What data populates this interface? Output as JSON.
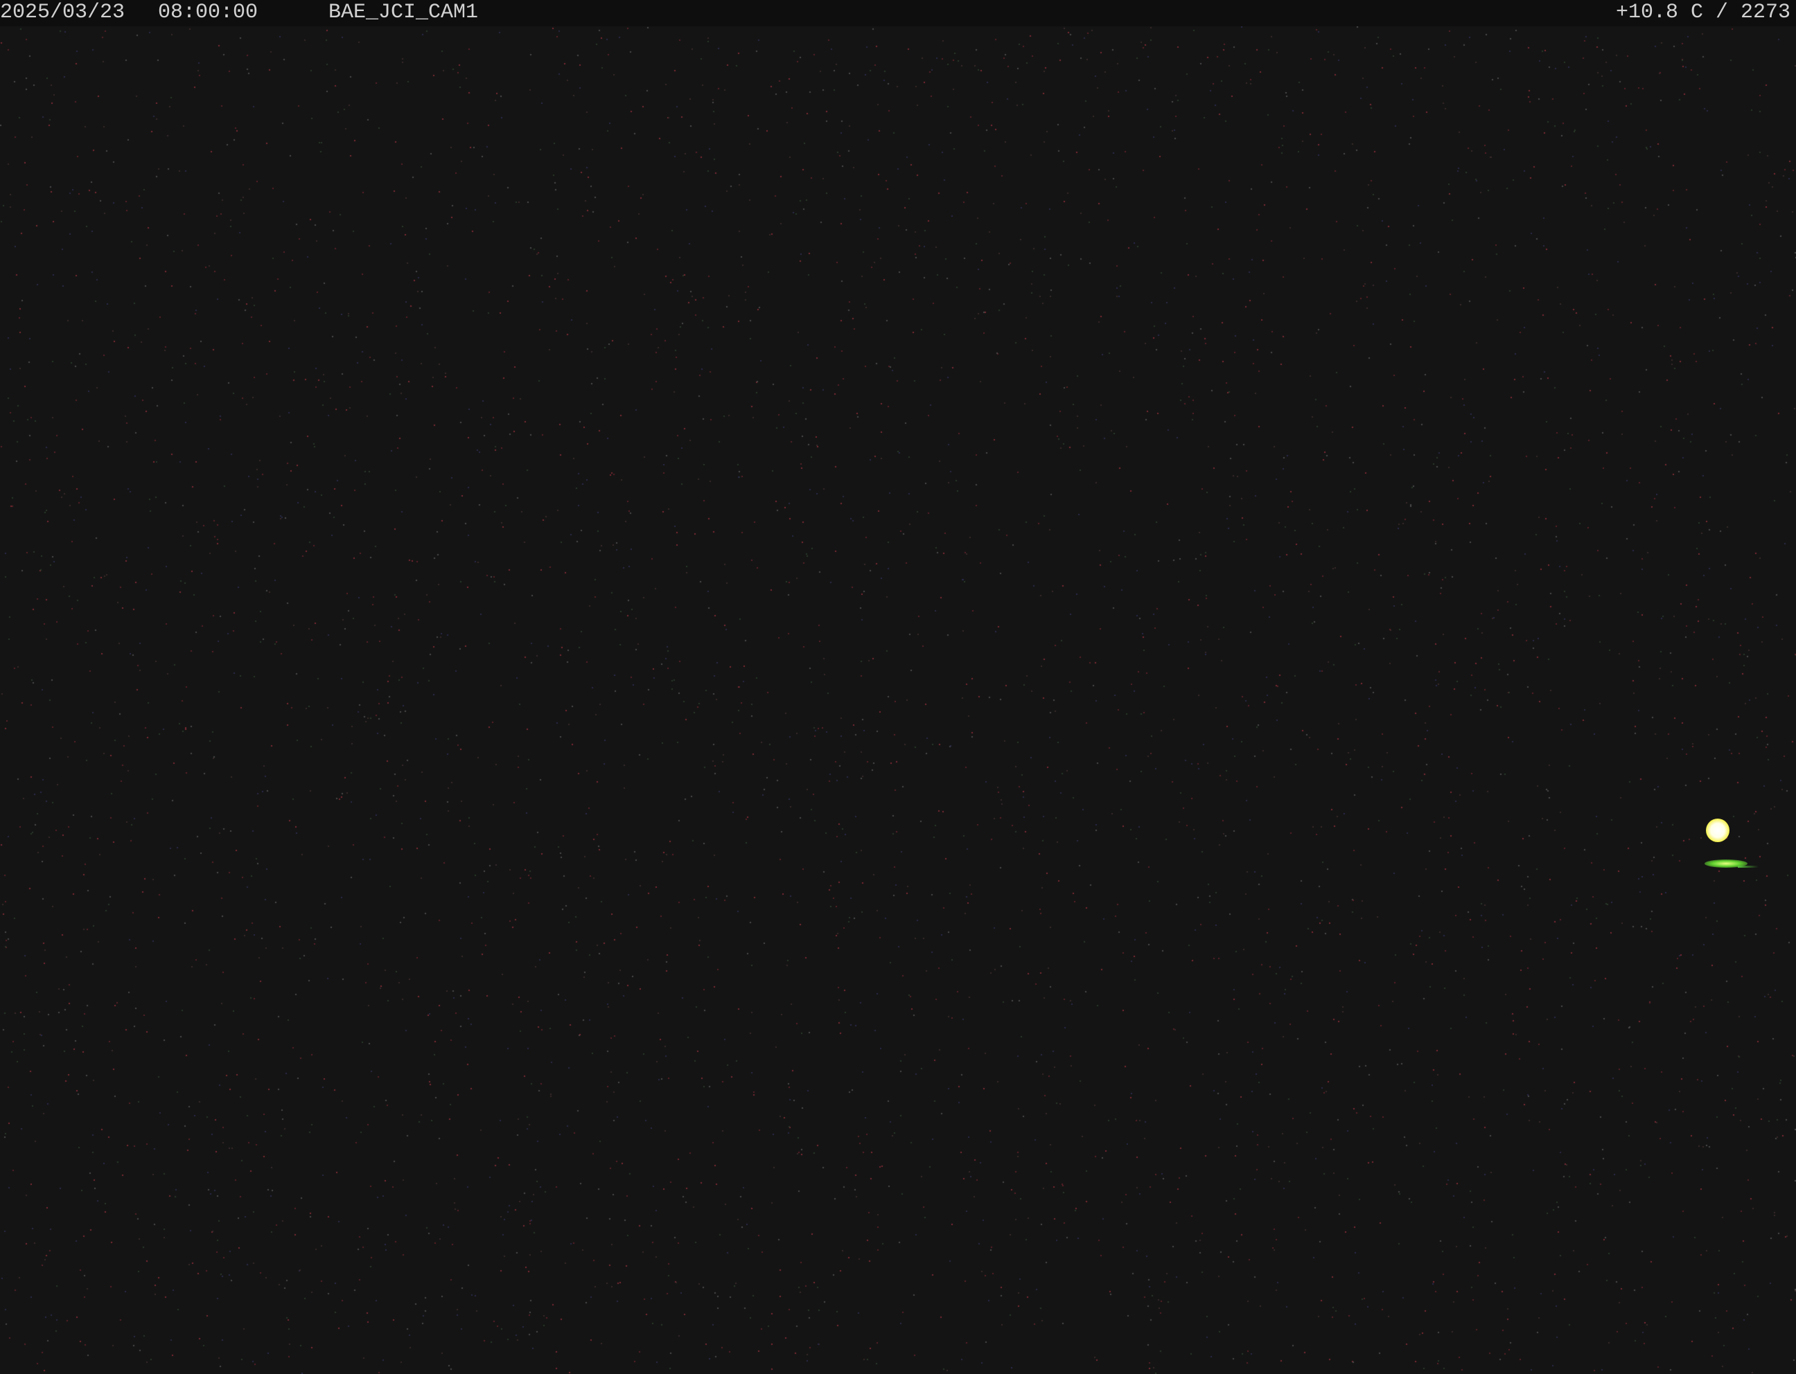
{
  "osd": {
    "date": "2025/03/23",
    "time": "08:00:00",
    "camera_id": "BAE_JCI_CAM1",
    "sensor_readout": "+10.8 C / 2273"
  },
  "colors": {
    "sky_background": "#141414",
    "osd_text": "#d2d2d2",
    "bright_object": "#f4f040",
    "glare": "#62d230"
  }
}
